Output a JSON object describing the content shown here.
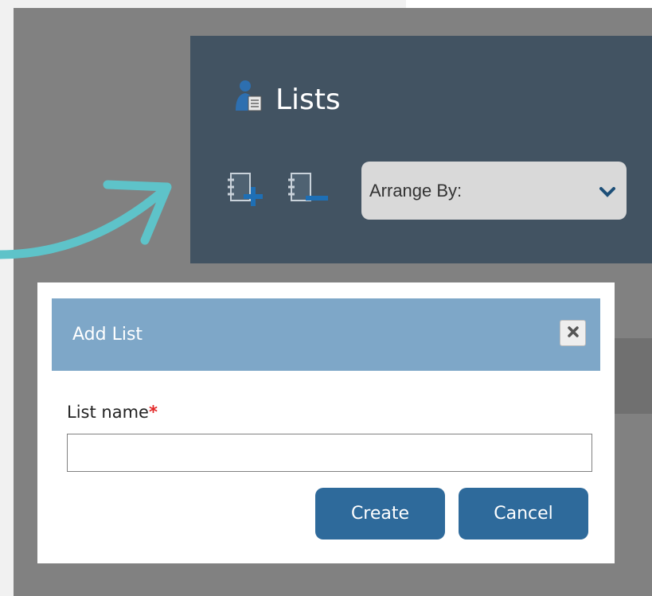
{
  "panel": {
    "title": "Lists",
    "toolbar": {
      "add_icon": "add-list-icon",
      "remove_icon": "remove-list-icon",
      "arrange_label": "Arrange By:",
      "arrange_icon": "chevron-down-icon"
    },
    "title_icon": "user-list-icon"
  },
  "annotation": {
    "arrow_color": "#5ec3c9"
  },
  "dialog": {
    "title": "Add List",
    "close_icon": "close-icon",
    "field_label": "List name",
    "required_marker": "*",
    "input_value": "",
    "create_label": "Create",
    "cancel_label": "Cancel"
  },
  "colors": {
    "overlay": "#818181",
    "panel": "#425362",
    "dialog_header": "#7ea7c8",
    "button": "#2e6a9b",
    "required": "#e32626"
  }
}
